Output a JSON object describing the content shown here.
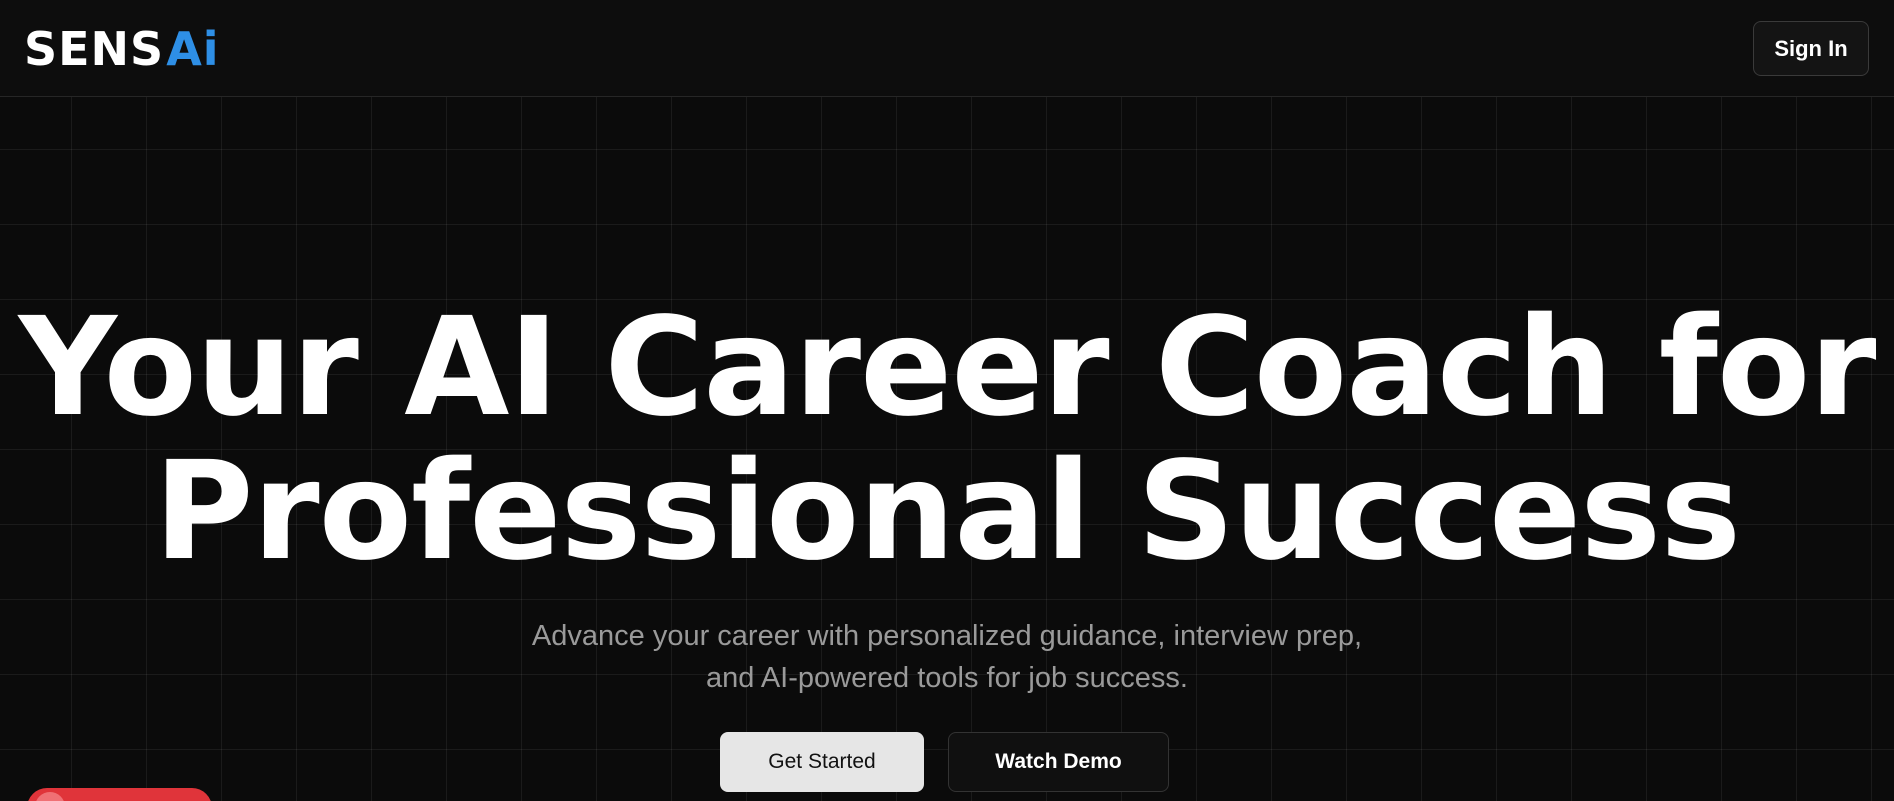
{
  "header": {
    "logo": {
      "main": "SENS",
      "accent": "Ai"
    },
    "signin_label": "Sign In"
  },
  "hero": {
    "title_line1": "Your AI Career Coach for",
    "title_line2": "Professional Success",
    "subtitle_line1": "Advance your career with personalized guidance, interview prep,",
    "subtitle_line2": "and AI-powered tools for job success.",
    "primary_button": "Get Started",
    "secondary_button": "Watch Demo"
  },
  "colors": {
    "background": "#0b0b0b",
    "logo_accent": "#2e8fe6",
    "primary_button_bg": "#e6e6e6",
    "badge": "#e0343a"
  }
}
